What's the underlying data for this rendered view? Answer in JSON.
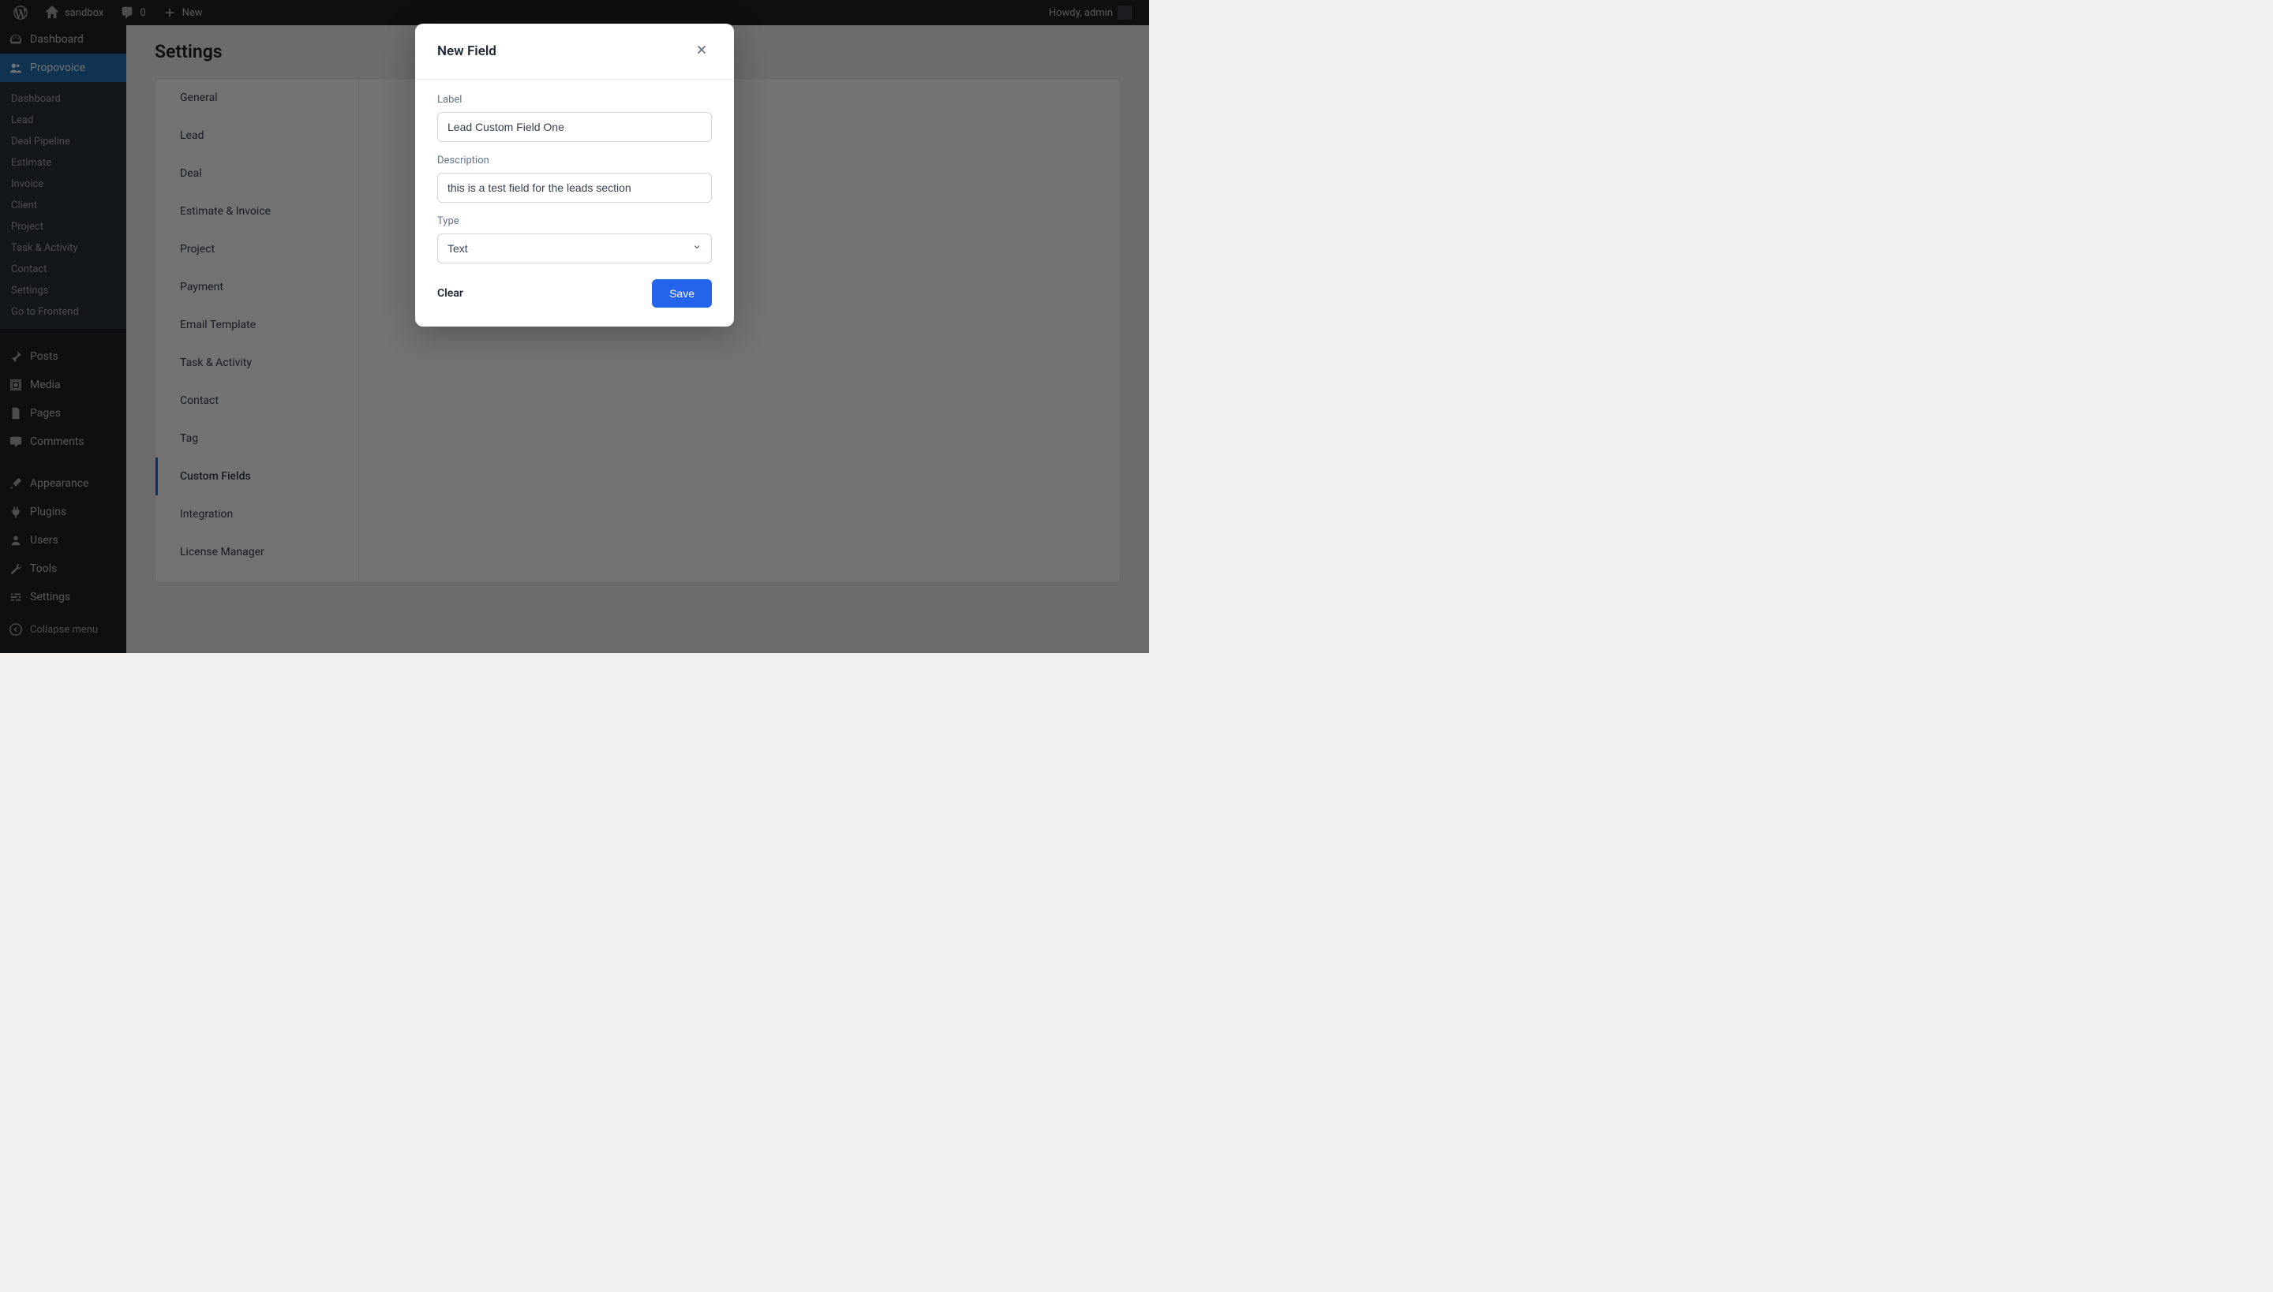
{
  "adminbar": {
    "site_name": "sandbox",
    "comment_count": "0",
    "new_label": "New",
    "howdy": "Howdy, admin"
  },
  "sidebar": {
    "dashboard": "Dashboard",
    "propovoice": "Propovoice",
    "sub": {
      "dashboard": "Dashboard",
      "lead": "Lead",
      "deal_pipeline": "Deal Pipeline",
      "estimate": "Estimate",
      "invoice": "Invoice",
      "client": "Client",
      "project": "Project",
      "task_activity": "Task & Activity",
      "contact": "Contact",
      "settings": "Settings",
      "go_frontend": "Go to Frontend"
    },
    "posts": "Posts",
    "media": "Media",
    "pages": "Pages",
    "comments": "Comments",
    "appearance": "Appearance",
    "plugins": "Plugins",
    "users": "Users",
    "tools": "Tools",
    "settings": "Settings",
    "collapse": "Collapse menu"
  },
  "main": {
    "title": "Settings",
    "tabs": {
      "general": "General",
      "lead": "Lead",
      "deal": "Deal",
      "estimate_invoice": "Estimate & Invoice",
      "project": "Project",
      "payment": "Payment",
      "email_template": "Email Template",
      "task_activity": "Task & Activity",
      "contact": "Contact",
      "tag": "Tag",
      "custom_fields": "Custom Fields",
      "integration": "Integration",
      "license_manager": "License Manager"
    }
  },
  "modal": {
    "title": "New Field",
    "label_label": "Label",
    "label_value": "Lead Custom Field One",
    "desc_label": "Description",
    "desc_value": "this is a test field for the leads section",
    "type_label": "Type",
    "type_value": "Text",
    "clear": "Clear",
    "save": "Save"
  }
}
